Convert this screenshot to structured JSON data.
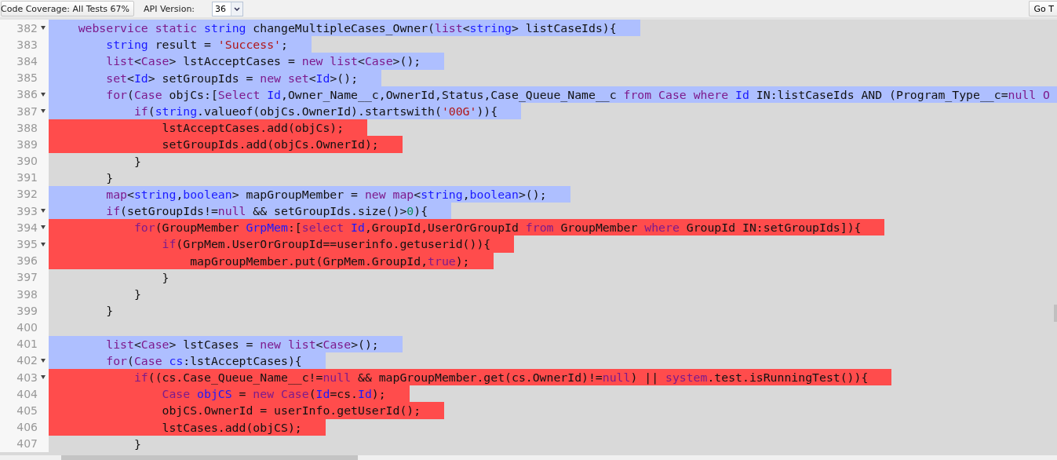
{
  "toolbar": {
    "coverage_menu": "Code Coverage: All Tests 67%",
    "api_label": "API Version:",
    "api_version": "36",
    "goto_button": "Go T"
  },
  "editor": {
    "lines": [
      {
        "number": "382",
        "fold": true,
        "kind": "covered",
        "tokens": [
          {
            "kind": "kw",
            "text": "    webservice "
          },
          {
            "kind": "kw",
            "text": "static "
          },
          {
            "kind": "type",
            "text": "string"
          },
          {
            "kind": "plain",
            "text": " changeMultipleCases_Owner("
          },
          {
            "kind": "kw",
            "text": "list"
          },
          {
            "kind": "plain",
            "text": "<"
          },
          {
            "kind": "type",
            "text": "string"
          },
          {
            "kind": "plain",
            "text": "> listCaseIds){"
          }
        ]
      },
      {
        "number": "383",
        "fold": false,
        "kind": "covered",
        "tokens": [
          {
            "kind": "type",
            "text": "        string"
          },
          {
            "kind": "plain",
            "text": " result = "
          },
          {
            "kind": "str",
            "text": "'Success'"
          },
          {
            "kind": "plain",
            "text": ";"
          }
        ]
      },
      {
        "number": "384",
        "fold": false,
        "kind": "covered",
        "tokens": [
          {
            "kind": "kw",
            "text": "        list"
          },
          {
            "kind": "plain",
            "text": "<"
          },
          {
            "kind": "kw",
            "text": "Case"
          },
          {
            "kind": "plain",
            "text": "> lstAcceptCases = "
          },
          {
            "kind": "kw",
            "text": "new list"
          },
          {
            "kind": "plain",
            "text": "<"
          },
          {
            "kind": "kw",
            "text": "Case"
          },
          {
            "kind": "plain",
            "text": ">();"
          }
        ]
      },
      {
        "number": "385",
        "fold": false,
        "kind": "covered",
        "tokens": [
          {
            "kind": "kw",
            "text": "        set"
          },
          {
            "kind": "plain",
            "text": "<"
          },
          {
            "kind": "type",
            "text": "Id"
          },
          {
            "kind": "plain",
            "text": "> setGroupIds = "
          },
          {
            "kind": "kw",
            "text": "new set"
          },
          {
            "kind": "plain",
            "text": "<"
          },
          {
            "kind": "type",
            "text": "Id"
          },
          {
            "kind": "plain",
            "text": ">();"
          }
        ]
      },
      {
        "number": "386",
        "fold": true,
        "kind": "covered",
        "tokens": [
          {
            "kind": "kw",
            "text": "        for"
          },
          {
            "kind": "plain",
            "text": "("
          },
          {
            "kind": "kw",
            "text": "Case"
          },
          {
            "kind": "plain",
            "text": " objCs:["
          },
          {
            "kind": "kw",
            "text": "Select "
          },
          {
            "kind": "type",
            "text": "Id"
          },
          {
            "kind": "plain",
            "text": ",Owner_Name__c,OwnerId,Status,Case_Queue_Name__c "
          },
          {
            "kind": "kw",
            "text": "from Case where "
          },
          {
            "kind": "type",
            "text": "Id"
          },
          {
            "kind": "plain",
            "text": " IN:listCaseIds AND (Program_Type__c="
          },
          {
            "kind": "kw",
            "text": "null O"
          }
        ]
      },
      {
        "number": "387",
        "fold": true,
        "kind": "covered",
        "tokens": [
          {
            "kind": "kw",
            "text": "            if"
          },
          {
            "kind": "plain",
            "text": "("
          },
          {
            "kind": "type",
            "text": "string"
          },
          {
            "kind": "plain",
            "text": ".valueof(objCs.OwnerId).startswith("
          },
          {
            "kind": "str",
            "text": "'00G'"
          },
          {
            "kind": "plain",
            "text": ")){"
          }
        ]
      },
      {
        "number": "388",
        "fold": false,
        "kind": "uncovered",
        "tokens": [
          {
            "kind": "plain",
            "text": "                lstAcceptCases.add(objCs);"
          }
        ]
      },
      {
        "number": "389",
        "fold": false,
        "kind": "uncovered",
        "tokens": [
          {
            "kind": "plain",
            "text": "                setGroupIds.add(objCs.OwnerId);"
          }
        ]
      },
      {
        "number": "390",
        "fold": false,
        "kind": "plain",
        "tokens": [
          {
            "kind": "plain",
            "text": "            }"
          }
        ]
      },
      {
        "number": "391",
        "fold": false,
        "kind": "plain",
        "tokens": [
          {
            "kind": "plain",
            "text": "        }"
          }
        ]
      },
      {
        "number": "392",
        "fold": false,
        "kind": "covered",
        "tokens": [
          {
            "kind": "kw",
            "text": "        map"
          },
          {
            "kind": "plain",
            "text": "<"
          },
          {
            "kind": "type",
            "text": "string"
          },
          {
            "kind": "plain",
            "text": ","
          },
          {
            "kind": "type",
            "text": "boolean"
          },
          {
            "kind": "plain",
            "text": "> mapGroupMember = "
          },
          {
            "kind": "kw",
            "text": "new map"
          },
          {
            "kind": "plain",
            "text": "<"
          },
          {
            "kind": "type",
            "text": "string"
          },
          {
            "kind": "plain",
            "text": ","
          },
          {
            "kind": "type",
            "text": "boolean"
          },
          {
            "kind": "plain",
            "text": ">();"
          }
        ]
      },
      {
        "number": "393",
        "fold": true,
        "kind": "covered",
        "tokens": [
          {
            "kind": "kw",
            "text": "        if"
          },
          {
            "kind": "plain",
            "text": "(setGroupIds!="
          },
          {
            "kind": "kw",
            "text": "null"
          },
          {
            "kind": "plain",
            "text": " && setGroupIds.size()>"
          },
          {
            "kind": "num",
            "text": "0"
          },
          {
            "kind": "plain",
            "text": "){"
          }
        ]
      },
      {
        "number": "394",
        "fold": true,
        "kind": "uncovered",
        "tokens": [
          {
            "kind": "kw",
            "text": "            for"
          },
          {
            "kind": "plain",
            "text": "(GroupMember "
          },
          {
            "kind": "type",
            "text": "GrpMem"
          },
          {
            "kind": "plain",
            "text": ":["
          },
          {
            "kind": "kw",
            "text": "select "
          },
          {
            "kind": "type",
            "text": "Id"
          },
          {
            "kind": "plain",
            "text": ",GroupId,UserOrGroupId "
          },
          {
            "kind": "kw",
            "text": "from"
          },
          {
            "kind": "plain",
            "text": " GroupMember "
          },
          {
            "kind": "kw",
            "text": "where"
          },
          {
            "kind": "plain",
            "text": " GroupId IN:setGroupIds]){"
          }
        ]
      },
      {
        "number": "395",
        "fold": true,
        "kind": "uncovered",
        "tokens": [
          {
            "kind": "kw",
            "text": "                if"
          },
          {
            "kind": "plain",
            "text": "(GrpMem.UserOrGroupId==userinfo.getuserid()){"
          }
        ]
      },
      {
        "number": "396",
        "fold": false,
        "kind": "uncovered",
        "tokens": [
          {
            "kind": "plain",
            "text": "                    mapGroupMember.put(GrpMem.GroupId,"
          },
          {
            "kind": "kw",
            "text": "true"
          },
          {
            "kind": "plain",
            "text": ");"
          }
        ]
      },
      {
        "number": "397",
        "fold": false,
        "kind": "plain",
        "tokens": [
          {
            "kind": "plain",
            "text": "                }"
          }
        ]
      },
      {
        "number": "398",
        "fold": false,
        "kind": "plain",
        "tokens": [
          {
            "kind": "plain",
            "text": "            }"
          }
        ]
      },
      {
        "number": "399",
        "fold": false,
        "kind": "plain",
        "tokens": [
          {
            "kind": "plain",
            "text": "        }"
          }
        ]
      },
      {
        "number": "400",
        "fold": false,
        "kind": "plain"
      },
      {
        "number": "401",
        "fold": false,
        "kind": "covered",
        "tokens": [
          {
            "kind": "kw",
            "text": "        list"
          },
          {
            "kind": "plain",
            "text": "<"
          },
          {
            "kind": "kw",
            "text": "Case"
          },
          {
            "kind": "plain",
            "text": "> lstCases = "
          },
          {
            "kind": "kw",
            "text": "new list"
          },
          {
            "kind": "plain",
            "text": "<"
          },
          {
            "kind": "kw",
            "text": "Case"
          },
          {
            "kind": "plain",
            "text": ">();"
          }
        ]
      },
      {
        "number": "402",
        "fold": true,
        "kind": "covered",
        "tokens": [
          {
            "kind": "kw",
            "text": "        for"
          },
          {
            "kind": "plain",
            "text": "("
          },
          {
            "kind": "kw",
            "text": "Case "
          },
          {
            "kind": "type",
            "text": "cs"
          },
          {
            "kind": "plain",
            "text": ":lstAcceptCases){"
          }
        ]
      },
      {
        "number": "403",
        "fold": true,
        "kind": "uncovered",
        "tokens": [
          {
            "kind": "kw",
            "text": "            if"
          },
          {
            "kind": "plain",
            "text": "((cs.Case_Queue_Name__c!="
          },
          {
            "kind": "kw",
            "text": "null"
          },
          {
            "kind": "plain",
            "text": " && mapGroupMember.get(cs.OwnerId)!="
          },
          {
            "kind": "kw",
            "text": "null"
          },
          {
            "kind": "plain",
            "text": ") || "
          },
          {
            "kind": "kw",
            "text": "system"
          },
          {
            "kind": "plain",
            "text": ".test.isRunningTest()){"
          }
        ]
      },
      {
        "number": "404",
        "fold": false,
        "kind": "uncovered",
        "tokens": [
          {
            "kind": "kw",
            "text": "                Case "
          },
          {
            "kind": "type",
            "text": "objCS"
          },
          {
            "kind": "plain",
            "text": " = "
          },
          {
            "kind": "kw",
            "text": "new Case"
          },
          {
            "kind": "plain",
            "text": "("
          },
          {
            "kind": "type",
            "text": "Id"
          },
          {
            "kind": "plain",
            "text": "=cs."
          },
          {
            "kind": "type",
            "text": "Id"
          },
          {
            "kind": "plain",
            "text": ");"
          }
        ]
      },
      {
        "number": "405",
        "fold": false,
        "kind": "uncovered",
        "tokens": [
          {
            "kind": "plain",
            "text": "                objCS.OwnerId = userInfo.getUserId();"
          }
        ]
      },
      {
        "number": "406",
        "fold": false,
        "kind": "uncovered",
        "tokens": [
          {
            "kind": "plain",
            "text": "                lstCases.add(objCS);"
          }
        ]
      },
      {
        "number": "407",
        "fold": false,
        "kind": "plain",
        "tokens": [
          {
            "kind": "plain",
            "text": "            }"
          }
        ]
      }
    ]
  }
}
